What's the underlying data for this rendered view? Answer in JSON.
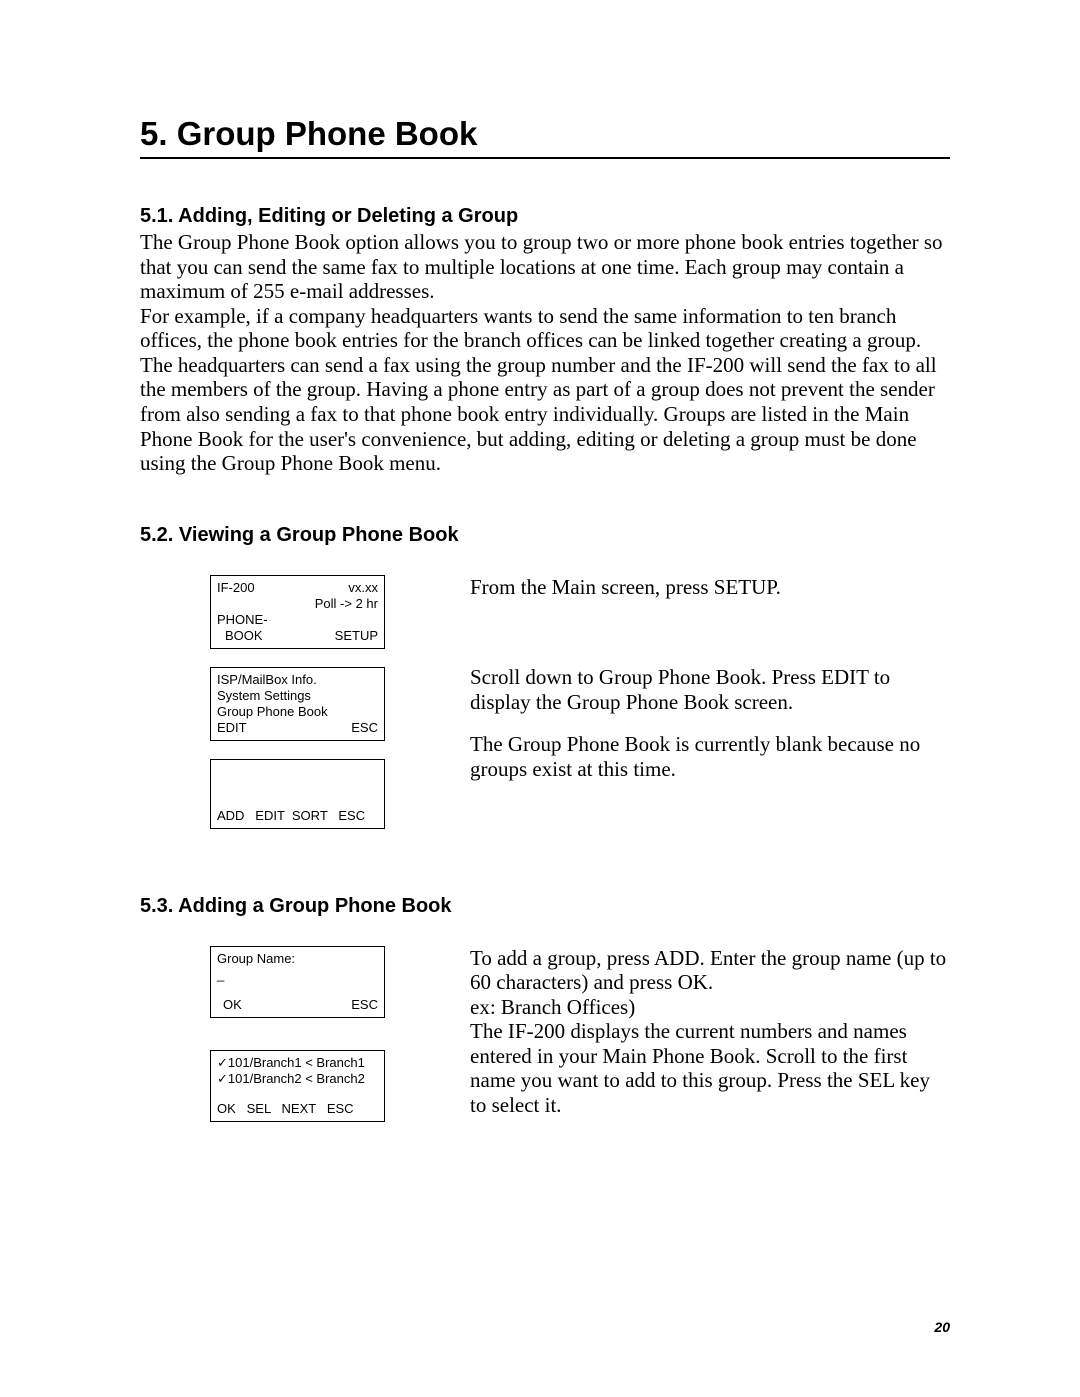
{
  "chapter": {
    "title": "5.  Group Phone Book"
  },
  "s1": {
    "head": "5.1.  Adding, Editing or Deleting a Group",
    "p1": "The Group Phone Book option allows you to group two or more phone book entries together so that you can send the same fax to multiple locations at one time.  Each group may contain a maximum of 255 e-mail addresses.",
    "p2": "For example, if a company headquarters wants to send the same information to ten branch offices, the phone book entries for the branch offices can be linked together creating a group. The headquarters can send a fax using the group number and the IF-200 will send the fax to all the members of the group. Having a phone entry as part of a group does not prevent the sender from also sending a fax to that phone book entry individually. Groups are listed in the Main Phone Book for the user's convenience, but adding, editing or deleting a group must be done using the Group Phone Book menu."
  },
  "s2": {
    "head": "5.2.  Viewing a Group Phone Book",
    "r1": "From the Main screen, press SETUP.",
    "r2": "Scroll down to Group Phone Book. Press EDIT to display the Group Phone Book screen.",
    "r3": "The Group Phone Book is currently blank because no groups exist at this time.",
    "box1": {
      "a": "IF-200",
      "b": "vx.xx",
      "c": "Poll ->  2 hr",
      "d": "PHONE-",
      "e": "BOOK",
      "f": "SETUP"
    },
    "box2": {
      "a": "ISP/MailBox Info.",
      "b": "System Settings",
      "c": "Group Phone Book",
      "d": "EDIT",
      "e": "ESC"
    },
    "box3": {
      "a": "ADD   EDIT  SORT   ESC"
    }
  },
  "s3": {
    "head": "5.3.  Adding a Group Phone Book",
    "r1": "To add a group, press ADD. Enter the group name (up to 60 characters) and press OK.",
    "r1b": "ex: Branch Offices)",
    "r2": "The IF-200 displays the current numbers and names entered in your Main Phone Book. Scroll to the first name you want to add to this group. Press the SEL key to select it.",
    "box4": {
      "a": "Group Name:",
      "b": "_",
      "c": "OK",
      "d": "ESC"
    },
    "box5": {
      "a": "✓101/Branch1 < Branch1",
      "b": "✓101/Branch2 < Branch2",
      "c": "OK   SEL   NEXT   ESC"
    }
  },
  "page_number": "20"
}
